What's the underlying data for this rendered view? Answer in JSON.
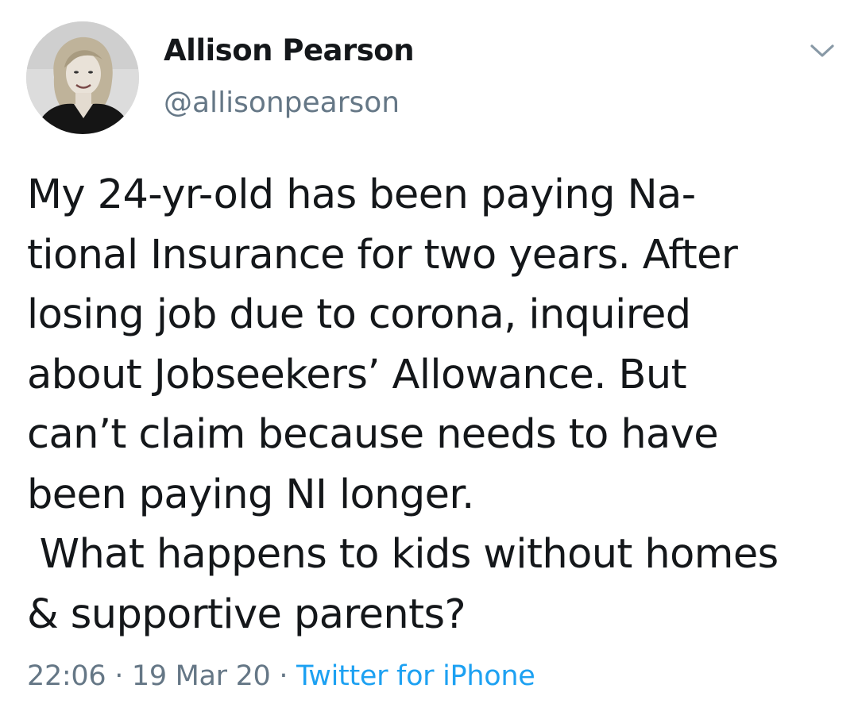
{
  "author": {
    "display_name": "Allison Pearson",
    "handle": "@allisonpearson",
    "avatar_icon": "profile-photo"
  },
  "menu_icon": "chevron-down-icon",
  "tweet": {
    "lines": [
      "My 24-yr-old has been paying Na-",
      "tional Insurance for two years. After",
      "losing job due to corona, inquired",
      "about Jobseekers’ Allowance. But",
      "can’t claim because needs to have",
      "been paying NI longer.",
      " What happens to kids without homes",
      "& supportive parents?"
    ]
  },
  "meta": {
    "time": "22:06",
    "separator": " · ",
    "date": "19 Mar 20",
    "source": "Twitter for iPhone"
  },
  "colors": {
    "text": "#14171a",
    "secondary": "#657786",
    "link": "#1da1f2"
  }
}
